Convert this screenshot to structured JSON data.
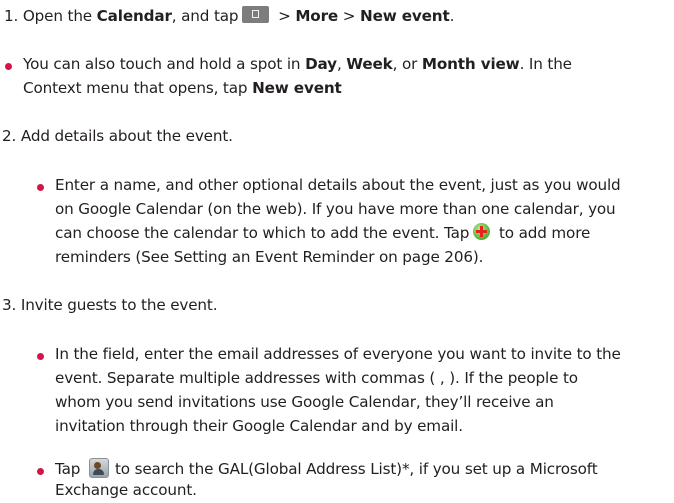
{
  "step1": {
    "a": "1. Open the ",
    "calendar": "Calendar",
    "b": ", and tap",
    "menu_icon": "menu-key-icon",
    "c": " > ",
    "more": "More",
    "d": " > ",
    "new_event": "New event",
    "e": "."
  },
  "tip": {
    "a": "You can also touch and hold a spot in ",
    "day": "Day",
    "b": ", ",
    "week": "Week",
    "c": ", or ",
    "month": "Month view",
    "d": ". In the",
    "line2": "Context menu that opens, tap ",
    "new_event": "New event"
  },
  "step2": {
    "heading": "2. Add details about the event.",
    "l1": "Enter a name, and other optional details about the event, just as you would",
    "l2": "on Google Calendar (on the web). If you have more than one calendar, you",
    "l3a": "can choose the calendar to which to add the event. Tap",
    "plus_icon": "add-reminder-plus-icon",
    "l3b": "to add more",
    "l4": "reminders (See Setting an Event Reminder on page 206)."
  },
  "step3": {
    "heading": "3. Invite guests to the event.",
    "l1": "In the field, enter the email addresses of everyone you want to invite to the",
    "l2": "event. Separate multiple addresses with commas ( , ). If the people to",
    "l3": "whom you send invitations use Google Calendar, they’ll receive an",
    "l4": "invitation through their Google Calendar and by email."
  },
  "gal": {
    "a": "Tap",
    "contact_icon": "contact-search-icon",
    "b": "to search the GAL(Global Address List)*, if you set up a Microsoft",
    "line2": "Exchange account."
  },
  "colors": {
    "bullet": "#d2144a",
    "text": "#231f20"
  }
}
